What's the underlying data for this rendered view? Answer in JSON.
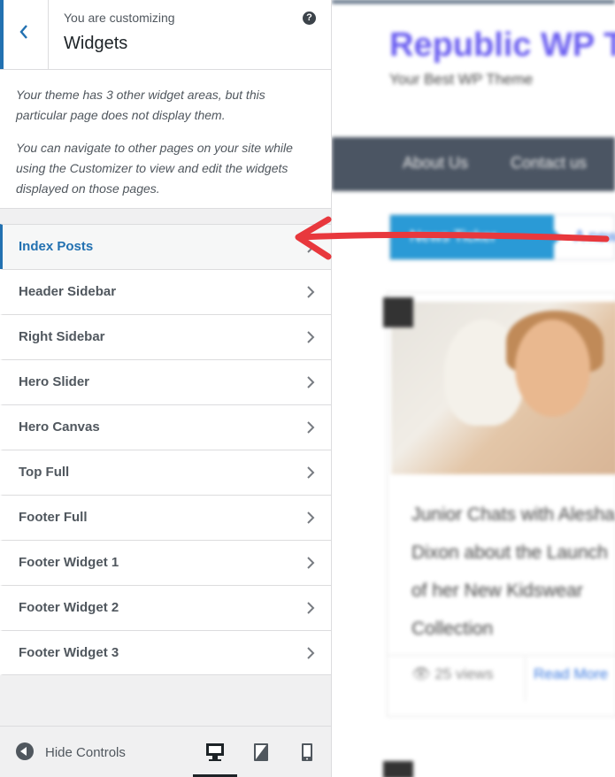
{
  "header": {
    "subtitle": "You are customizing",
    "title": "Widgets",
    "help_glyph": "?"
  },
  "description": {
    "paragraph1": "Your theme has 3 other widget areas, but this particular page does not display them.",
    "paragraph2": "You can navigate to other pages on your site while using the Customizer to view and edit the widgets displayed on those pages."
  },
  "sections": [
    {
      "label": "Index Posts",
      "active": true
    },
    {
      "label": "Header Sidebar"
    },
    {
      "label": "Right Sidebar"
    },
    {
      "label": "Hero Slider"
    },
    {
      "label": "Hero Canvas"
    },
    {
      "label": "Top Full"
    },
    {
      "label": "Footer Full"
    },
    {
      "label": "Footer Widget 1"
    },
    {
      "label": "Footer Widget 2"
    },
    {
      "label": "Footer Widget 3"
    }
  ],
  "footer": {
    "hide_controls_label": "Hide Controls",
    "devices": [
      "desktop-icon",
      "tablet-icon",
      "mobile-icon"
    ],
    "selected_device": "desktop"
  },
  "preview": {
    "site_title": "Republic WP T",
    "tagline": "Your Best WP Theme",
    "nav": [
      "About Us",
      "Contact us"
    ],
    "ticker_label": "News Ticker",
    "ticker_text": "A new",
    "post_title": "Junior Chats with Alesha Dixon about the Launch of her New Kidswear Collection",
    "views": "25 views",
    "read_more": "Read More"
  },
  "colors": {
    "accent": "#2271b1",
    "annotation_arrow": "#e8383d",
    "site_title": "#6a5df0",
    "navbar": "#4b5563",
    "ticker": "#2a9ad6"
  }
}
